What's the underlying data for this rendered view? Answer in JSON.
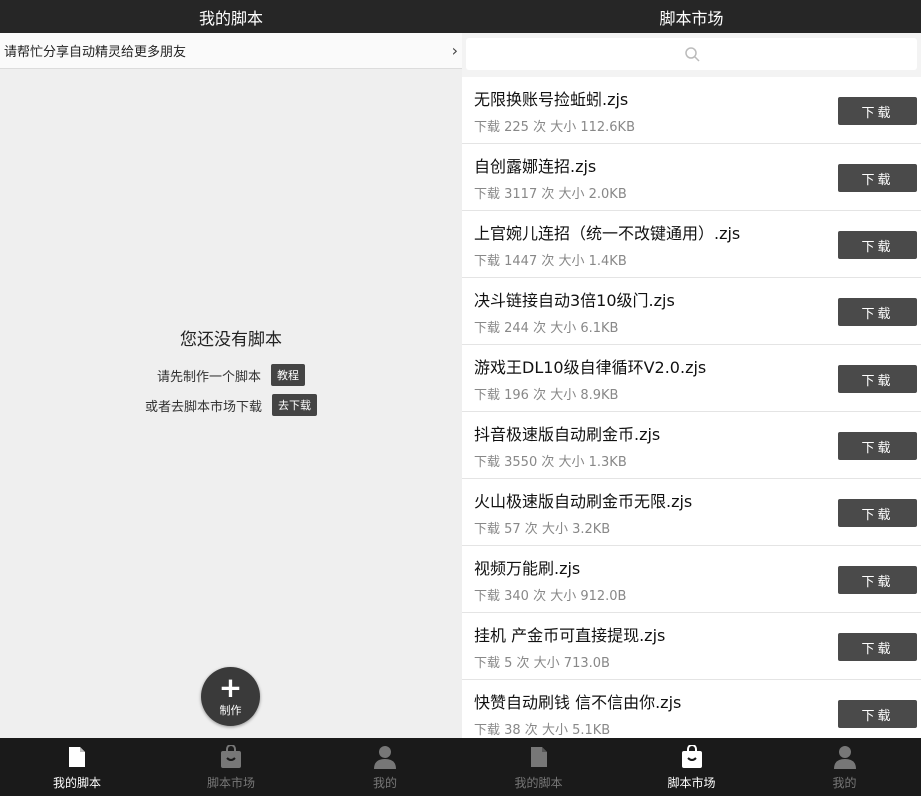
{
  "left": {
    "title": "我的脚本",
    "share_banner": "请帮忙分享自动精灵给更多朋友",
    "empty_title": "您还没有脚本",
    "empty_line1": "请先制作一个脚本",
    "tutorial_btn": "教程",
    "empty_line2": "或者去脚本市场下载",
    "goto_download_btn": "去下载",
    "fab_label": "制作",
    "nav": {
      "items": [
        {
          "label": "我的脚本",
          "icon": "document-icon",
          "active": true
        },
        {
          "label": "脚本市场",
          "icon": "shopping-bag-icon",
          "active": false
        },
        {
          "label": "我的",
          "icon": "person-icon",
          "active": false
        }
      ]
    }
  },
  "right": {
    "title": "脚本市场",
    "search_icon": "search-icon",
    "download_label": "下载",
    "scripts": [
      {
        "name": "无限换账号捡蚯蚓.zjs",
        "meta": "下载 225 次 大小 112.6KB"
      },
      {
        "name": "自创露娜连招.zjs",
        "meta": "下载 3117 次 大小 2.0KB"
      },
      {
        "name": "上官婉儿连招（统一不改键通用）.zjs",
        "meta": "下载 1447 次 大小 1.4KB"
      },
      {
        "name": "决斗链接自动3倍10级门.zjs",
        "meta": "下载 244 次 大小 6.1KB"
      },
      {
        "name": "游戏王DL10级自律循环V2.0.zjs",
        "meta": "下载 196 次 大小 8.9KB"
      },
      {
        "name": "抖音极速版自动刷金币.zjs",
        "meta": "下载 3550 次 大小 1.3KB"
      },
      {
        "name": "火山极速版自动刷金币无限.zjs",
        "meta": "下载 57 次 大小 3.2KB"
      },
      {
        "name": "视频万能刷.zjs",
        "meta": "下载 340 次 大小 912.0B"
      },
      {
        "name": "挂机 产金币可直接提现.zjs",
        "meta": "下载 5 次 大小 713.0B"
      },
      {
        "name": "快赞自动刷钱 信不信由你.zjs",
        "meta": "下载 38 次 大小 5.1KB"
      }
    ],
    "nav": {
      "items": [
        {
          "label": "我的脚本",
          "icon": "document-icon",
          "active": false
        },
        {
          "label": "脚本市场",
          "icon": "shopping-bag-icon",
          "active": true
        },
        {
          "label": "我的",
          "icon": "person-icon",
          "active": false
        }
      ]
    }
  }
}
